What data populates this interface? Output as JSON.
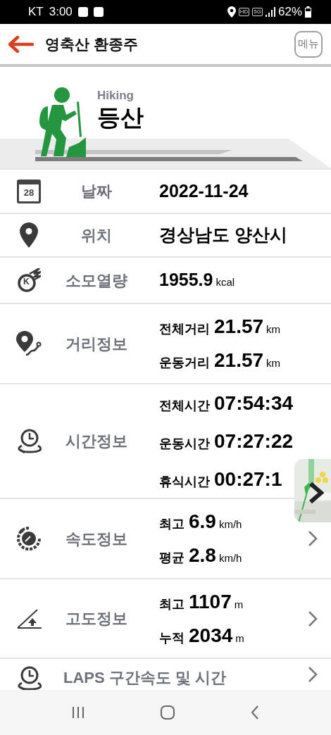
{
  "status_bar": {
    "carrier": "KT",
    "time": "3:00",
    "network_badges": [
      "HD",
      "5G"
    ],
    "battery": "62%"
  },
  "header": {
    "title": "영축산 환종주",
    "menu_button": "메뉴"
  },
  "activity": {
    "subtitle": "Hiking",
    "title": "등산"
  },
  "rows": [
    {
      "icon_text": "28",
      "label": "날짜",
      "kind": "single",
      "value": "2022-11-24",
      "chevron": false
    },
    {
      "label": "위치",
      "kind": "single",
      "value": "경상남도 양산시",
      "chevron": false
    },
    {
      "icon_text": "K",
      "label": "소모열량",
      "kind": "single",
      "value": "1955.9",
      "unit": "kcal",
      "chevron": false
    },
    {
      "label": "거리정보",
      "kind": "multi",
      "chevron": false,
      "lines": [
        {
          "name": "전체거리",
          "value": "21.57",
          "unit": "km"
        },
        {
          "name": "운동거리",
          "value": "21.57",
          "unit": "km"
        }
      ]
    },
    {
      "label": "시간정보",
      "kind": "multi",
      "chevron": false,
      "lines": [
        {
          "name": "전체시간",
          "value": "07:54:34"
        },
        {
          "name": "운동시간",
          "value": "07:27:22"
        },
        {
          "name": "휴식시간",
          "value": "00:27:1"
        }
      ]
    },
    {
      "label": "속도정보",
      "kind": "multi",
      "chevron": true,
      "lines": [
        {
          "name": "최고",
          "value": "6.9",
          "unit": "km/h"
        },
        {
          "name": "평균",
          "value": "2.8",
          "unit": "km/h"
        }
      ]
    },
    {
      "label": "고도정보",
      "kind": "multi",
      "chevron": true,
      "lines": [
        {
          "name": "최고",
          "value": "1107",
          "unit": "m"
        },
        {
          "name": "누적",
          "value": "2034",
          "unit": "m"
        }
      ]
    },
    {
      "label": "LAPS 구간속도 및 시간",
      "kind": "wide",
      "chevron": true
    }
  ]
}
